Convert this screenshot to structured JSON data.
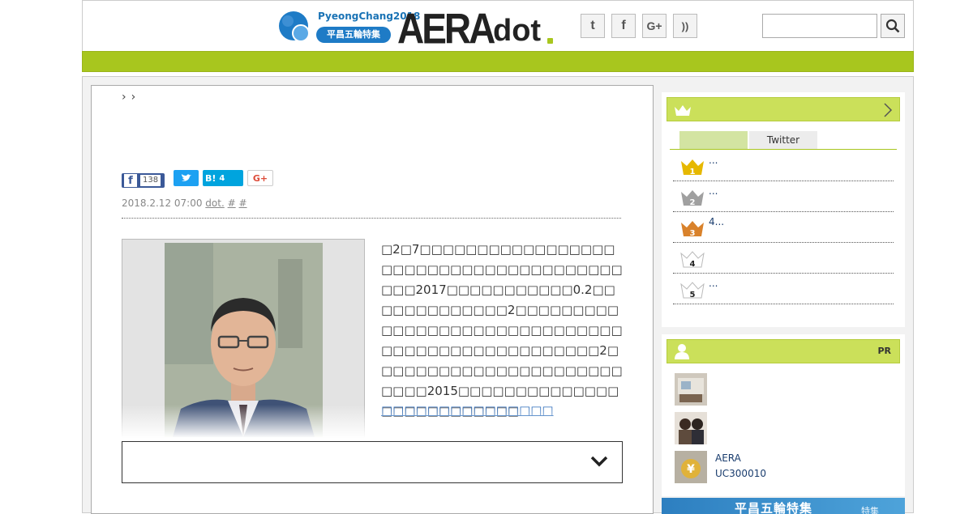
{
  "header": {
    "pc_logo_text": "PyeongChang2018",
    "pc_badge": "平昌五輪特集",
    "logo_main": "AERA",
    "logo_sub": "dot",
    "social": [
      "twitter-icon",
      "facebook-icon",
      "google-plus-icon",
      "rss-icon"
    ],
    "social_glyphs": [
      "t",
      "f",
      "G+",
      "))"
    ],
    "search_placeholder": ""
  },
  "breadcrumb": [
    "›",
    "›"
  ],
  "share": {
    "facebook_count": "138",
    "hatena_label": "B!",
    "hatena_count": "4",
    "gplus_label": "G+"
  },
  "meta": {
    "date": "2018.2.12 07:00",
    "source_link": "dot.",
    "tag1": "#",
    "tag2": "#"
  },
  "article": {
    "body": "□2□7□□□□□□□□□□□□□□□□□□□□□□□□□□□□□□□□□□□□□□□□□2017□□□□□□□□□□□0.2□□□□□□□□□□□□□2□□□□□□□□□□□□□□□□□□□□□□□□□□□□□□□□□□□□□□□□□□□□□□□□□2□□□□□□□□□□□□□□□□□□□□□□□□□□2015□□□□□□□□□□□□□□□□□□□□□□□□□□",
    "read_more": "□□□□□□□□□□□□□□□"
  },
  "sidebar": {
    "ranking_tabs": [
      "",
      "Twitter"
    ],
    "ranking": [
      {
        "rank": "1",
        "text": "...",
        "color": "#e6b800"
      },
      {
        "rank": "2",
        "text": "...",
        "color": "#a0a0a0"
      },
      {
        "rank": "3",
        "text": "4...",
        "color": "#d9822b"
      },
      {
        "rank": "4",
        "text": "",
        "color": "#ffffff"
      },
      {
        "rank": "5",
        "text": "...",
        "color": "#ffffff"
      }
    ],
    "pr_label": "PR",
    "pr_items": [
      {
        "line1": "",
        "line2": ""
      },
      {
        "line1": "",
        "line2": ""
      },
      {
        "line1": "AERA",
        "line2": "UC300010"
      }
    ],
    "banner_text": "平昌五輪特集",
    "banner_sub": "特集"
  },
  "colors": {
    "accent_green": "#a8c61e",
    "light_green": "#cbe05a",
    "link_blue": "#1a5fb4",
    "twitter": "#1da1f2",
    "facebook": "#3b5998",
    "hatena": "#00a4de"
  }
}
